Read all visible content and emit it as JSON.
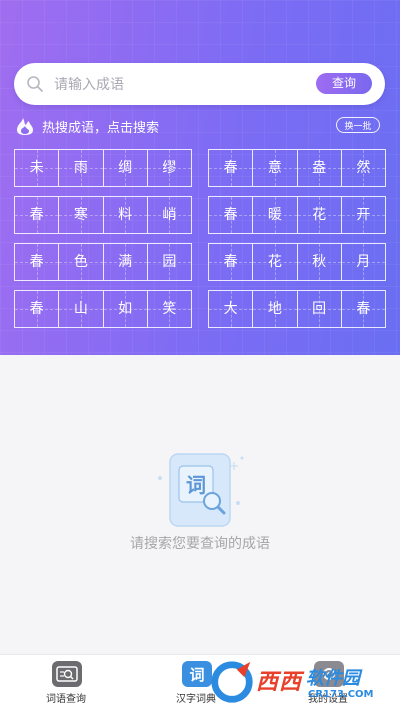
{
  "search": {
    "placeholder": "请输入成语",
    "button_label": "查询"
  },
  "hot": {
    "title": "热搜成语，点击搜索",
    "refresh_label": "换一批",
    "idioms": [
      [
        "未",
        "雨",
        "绸",
        "缪"
      ],
      [
        "春",
        "意",
        "盎",
        "然"
      ],
      [
        "春",
        "寒",
        "料",
        "峭"
      ],
      [
        "春",
        "暖",
        "花",
        "开"
      ],
      [
        "春",
        "色",
        "满",
        "园"
      ],
      [
        "春",
        "花",
        "秋",
        "月"
      ],
      [
        "春",
        "山",
        "如",
        "笑"
      ],
      [
        "大",
        "地",
        "回",
        "春"
      ]
    ]
  },
  "empty_state": {
    "icon_char": "词",
    "message": "请搜索您要查询的成语"
  },
  "tabbar": {
    "tabs": [
      {
        "label": "词语查询",
        "icon": "idiom-search-icon"
      },
      {
        "label": "汉字词典",
        "icon": "dictionary-icon",
        "icon_char": "词"
      },
      {
        "label": "我的设置",
        "icon": "settings-icon"
      }
    ]
  },
  "watermark": {
    "brand": "西西",
    "brand2": "软件园",
    "sub": "CR173.COM"
  },
  "colors": {
    "gradient_start": "#a06df0",
    "gradient_end": "#6a6ef2",
    "accent": "#7a68f0",
    "muted_text": "#a6a6ab"
  }
}
